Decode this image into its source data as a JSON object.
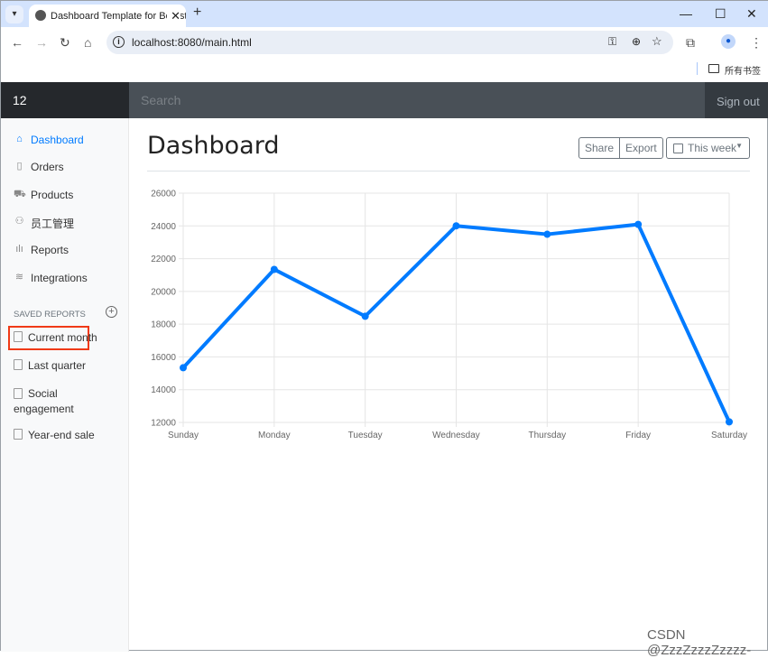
{
  "browser": {
    "tab_title": "Dashboard Template for Bootstrap",
    "url": "localhost:8080/main.html",
    "bookmarks_label": "所有书签"
  },
  "navbar": {
    "brand": "12",
    "search_placeholder": "Search",
    "signout": "Sign out"
  },
  "sidebar": {
    "items": [
      {
        "label": "Dashboard",
        "icon": "home-icon",
        "active": true
      },
      {
        "label": "Orders",
        "icon": "file-icon"
      },
      {
        "label": "Products",
        "icon": "shopping-cart-icon"
      },
      {
        "label": "员工管理",
        "icon": "users-icon",
        "highlighted": true
      },
      {
        "label": "Reports",
        "icon": "bar-chart-icon"
      },
      {
        "label": "Integrations",
        "icon": "layers-icon"
      }
    ],
    "saved_heading": "SAVED REPORTS",
    "saved": [
      {
        "label": "Current month"
      },
      {
        "label": "Last quarter"
      },
      {
        "label": "Social engagement"
      },
      {
        "label": "Year-end sale"
      }
    ]
  },
  "main": {
    "title": "Dashboard",
    "share": "Share",
    "export": "Export",
    "period": "This week"
  },
  "watermark": "CSDN @ZzzZzzzZzzzz-",
  "chart_data": {
    "type": "line",
    "categories": [
      "Sunday",
      "Monday",
      "Tuesday",
      "Wednesday",
      "Thursday",
      "Friday",
      "Saturday"
    ],
    "values": [
      15339,
      21345,
      18483,
      24003,
      23489,
      24092,
      12034
    ],
    "ylim": [
      12000,
      26000
    ],
    "yticks": [
      12000,
      14000,
      16000,
      18000,
      20000,
      22000,
      24000,
      26000
    ],
    "grid": true,
    "color": "#007bff",
    "legend": "none"
  }
}
